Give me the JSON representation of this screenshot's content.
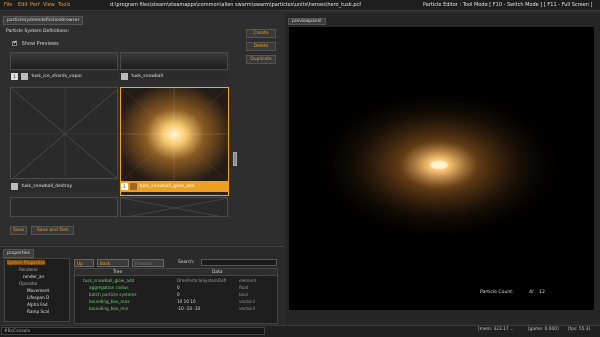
{
  "menubar": {
    "items": [
      "File",
      "Edit",
      "Perf",
      "View",
      "Tools"
    ],
    "path": "d:\\program files\\steam\\steamapps\\common\\alien swarm\\swarm\\particles\\units\\heroes\\hero_tusk.pcf",
    "mode": "Particle Editor : Tool Mode [ F10 - Switch Mode ] [ F11 - Full Screen ]"
  },
  "browser": {
    "tab": "particlesystemdefinitionbrowser",
    "label": "Particle System Definitions:",
    "show_previews": "Show Previews",
    "buttons": {
      "create": "Create",
      "delete": "Delete",
      "duplicate": "Duplicate"
    },
    "thumbnails": [
      {
        "name": "tusk_ice_shards_vapor",
        "num": "1"
      },
      {
        "name": "tusk_snowball",
        "num": ""
      },
      {
        "name": "tusk_snowball_destroy",
        "num": ""
      },
      {
        "name": "tusk_snowball_glow_add",
        "num": "1"
      }
    ],
    "save": "Save",
    "save_text": "Save and Test"
  },
  "properties": {
    "tab": "properties",
    "tree": [
      "System Properties",
      "Renderer",
      "render_an",
      "Operator",
      "Movement",
      "Lifespan D",
      "Alpha Fad",
      "Ramp Scal"
    ],
    "controls": {
      "up": "Up",
      "back": "Back",
      "forward": "Forward",
      "search": "Search:"
    },
    "columns": [
      "Tree",
      "Data"
    ],
    "rows": [
      {
        "tree": "tusk_snowball_glow_add",
        "data": "DmeParticleSystemDefi",
        "type": "element"
      },
      {
        "tree": "aggregation radius",
        "data": "0",
        "type": "float"
      },
      {
        "tree": "batch particle systems",
        "data": "0",
        "type": "bool"
      },
      {
        "tree": "bounding_box_max",
        "data": "10 10 10",
        "type": "vector3"
      },
      {
        "tree": "bounding_box_min",
        "data": "-10 -10 -10",
        "type": "vector3"
      }
    ]
  },
  "preview": {
    "tab": "previewpanel",
    "count_label": "Particle Count:",
    "count_value": "4/",
    "count_max": "12"
  },
  "status": {
    "console": "#BxConsole",
    "mem": "[mem: 323.17 ...",
    "game": "[game: 0.000]",
    "fps": "[fps: 55.3]"
  },
  "colors": {
    "accent": "#f0a020",
    "selection": "#f2a820",
    "background": "#2b2b2b"
  }
}
